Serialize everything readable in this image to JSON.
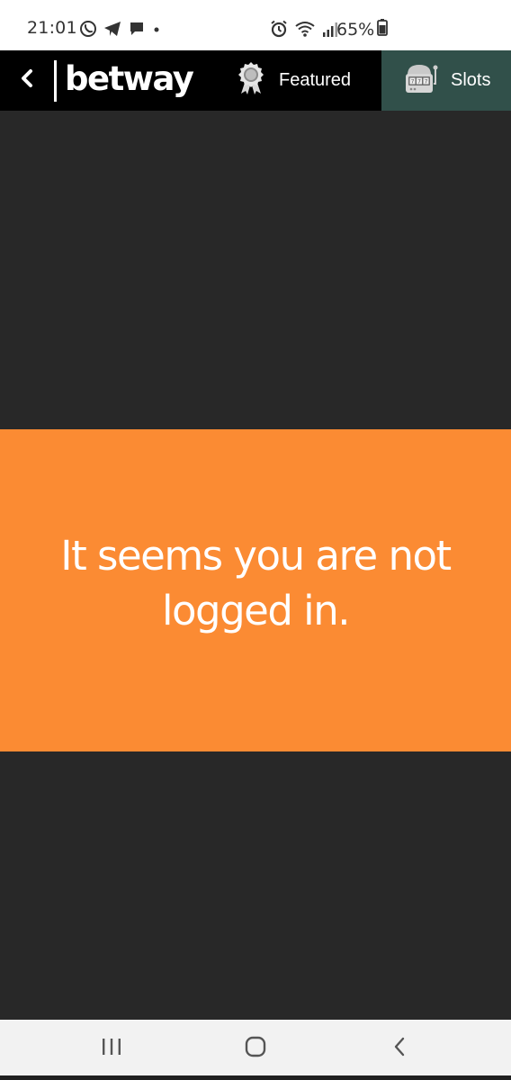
{
  "status_bar": {
    "time": "21:01",
    "battery": "65%",
    "icons_left": [
      "whatsapp-icon",
      "telegram-icon",
      "message-icon",
      "dot-icon"
    ],
    "icons_right": [
      "alarm-icon",
      "wifi-icon",
      "signal-icon"
    ]
  },
  "header": {
    "logo": "betway",
    "tabs": [
      {
        "label": "Featured",
        "icon": "award-icon",
        "active": false
      },
      {
        "label": "Slots",
        "icon": "slot-machine-icon",
        "active": true
      }
    ]
  },
  "main": {
    "message": "It seems you are not logged in."
  },
  "colors": {
    "header_bg": "#000000",
    "active_tab_bg": "#31504a",
    "banner_bg": "#fb8b33",
    "page_bg": "#282828"
  }
}
